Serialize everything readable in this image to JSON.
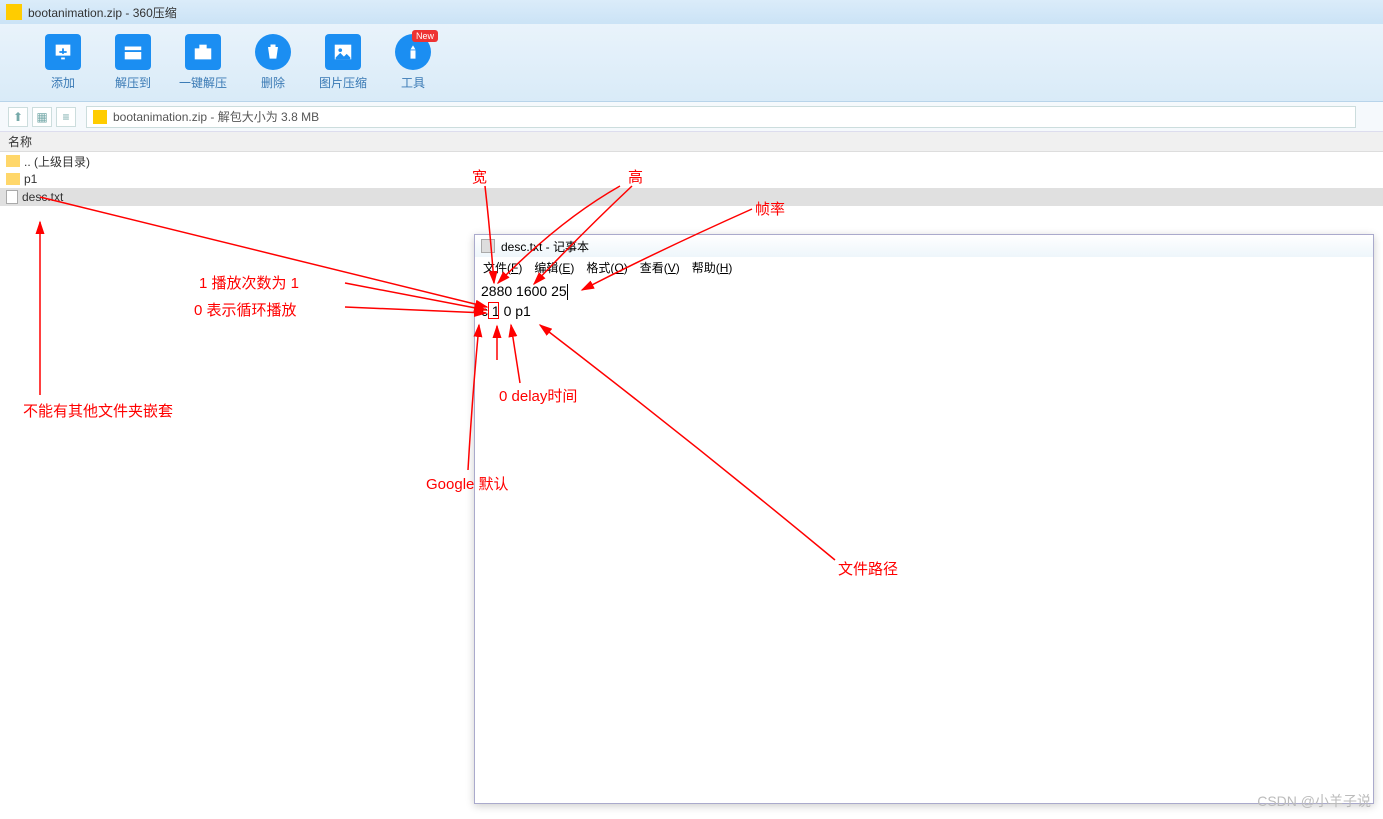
{
  "titlebar": {
    "title": "bootanimation.zip - 360压缩"
  },
  "toolbar": {
    "add": "添加",
    "extract": "解压到",
    "onekey": "一键解压",
    "delete": "删除",
    "image_compress": "图片压缩",
    "tools": "工具",
    "badge": "New"
  },
  "pathbar": {
    "address": "bootanimation.zip - 解包大小为 3.8 MB"
  },
  "columns": {
    "name": "名称"
  },
  "files": {
    "parent": ".. (上级目录)",
    "p1": "p1",
    "desc": "desc.txt"
  },
  "notepad": {
    "title": "desc.txt - 记事本",
    "menu_file": "文件(F)",
    "menu_edit": "编辑(E)",
    "menu_format": "格式(O)",
    "menu_view": "查看(V)",
    "menu_help": "帮助(H)",
    "line1": "2880 1600 25",
    "line2": "c 1 0 p1"
  },
  "anno": {
    "width": "宽",
    "height": "高",
    "fps": "帧率",
    "play1": "1 播放次数为 1",
    "play0": "0 表示循环播放",
    "nested": "不能有其他文件夹嵌套",
    "delay": "0 delay时间",
    "google": "Google 默认",
    "path": "文件路径"
  },
  "watermark": "CSDN @小羊子说"
}
